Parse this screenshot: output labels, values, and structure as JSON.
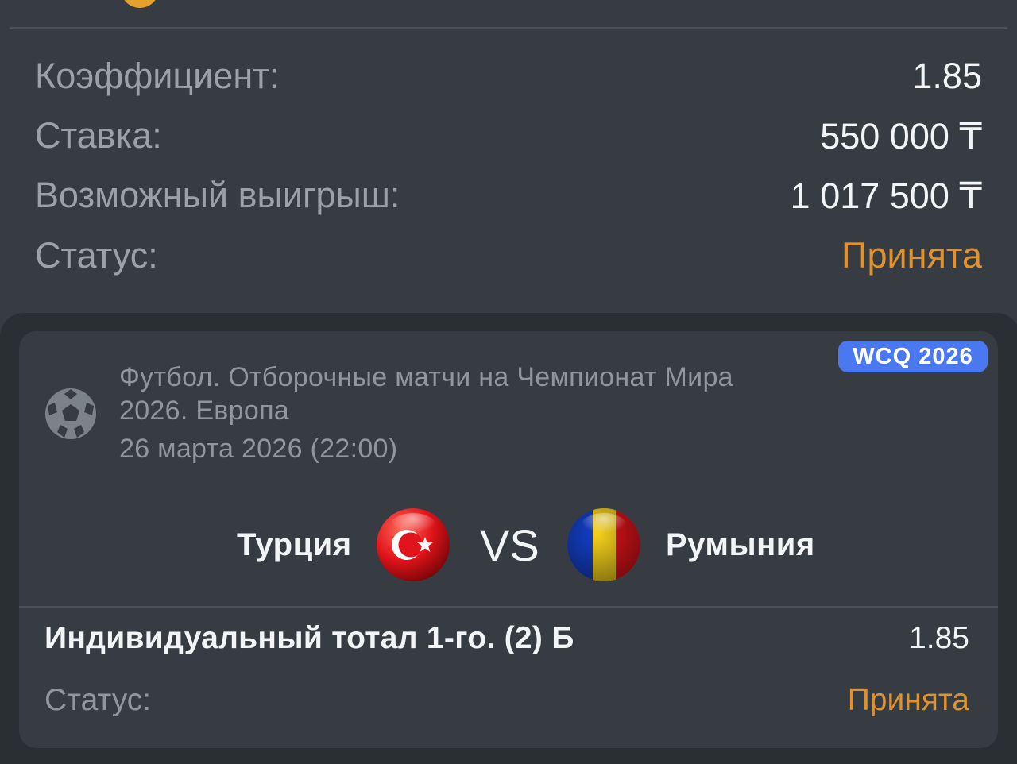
{
  "summary": {
    "coef_label": "Коэффициент:",
    "coef_value": "1.85",
    "stake_label": "Ставка:",
    "stake_value": "550 000 ₸",
    "win_label": "Возможный выигрыш:",
    "win_value": "1 017 500 ₸",
    "status_label": "Статус:",
    "status_value": "Принята"
  },
  "event": {
    "badge": "WCQ 2026",
    "league_line1": "Футбол. Отборочные матчи на Чемпионат Мира",
    "league_line2": "2026. Европа",
    "datetime": "26 марта 2026 (22:00)",
    "home_team": "Турция",
    "vs": "VS",
    "away_team": "Румыния",
    "sport_icon": "soccer-ball-icon"
  },
  "bet": {
    "name": "Индивидуальный тотал 1-го. (2) Б",
    "odds": "1.85",
    "status_label": "Статус:",
    "status_value": "Принята"
  },
  "colors": {
    "background": "#363c41",
    "status": "#e0922e",
    "badge": "#4a78f0"
  }
}
